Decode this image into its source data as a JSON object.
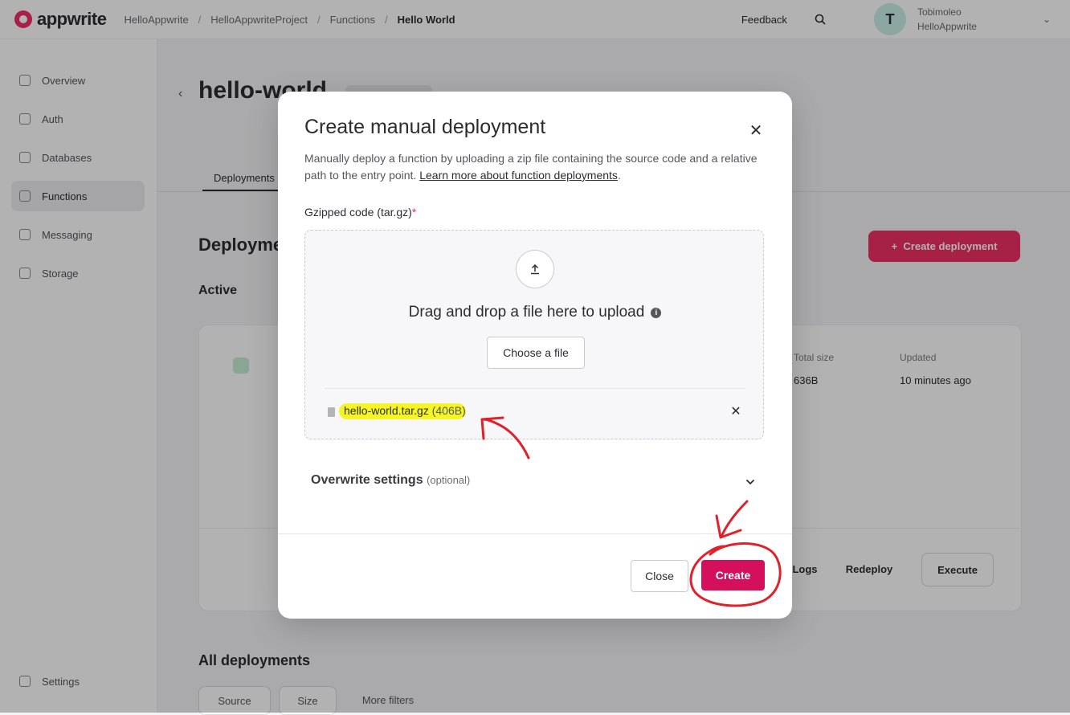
{
  "app": {
    "logo_text": "appwrite"
  },
  "breadcrumbs": [
    "HelloAppwrite",
    "HelloAppwriteProject",
    "Functions",
    "Hello World"
  ],
  "header": {
    "feedback": "Feedback",
    "user_initial": "T",
    "user_name": "Tobimoleo",
    "user_org": "HelloAppwrite"
  },
  "sidebar": {
    "items": [
      {
        "label": "Overview"
      },
      {
        "label": "Auth"
      },
      {
        "label": "Databases"
      },
      {
        "label": "Functions"
      },
      {
        "label": "Messaging"
      },
      {
        "label": "Storage"
      }
    ],
    "settings": "Settings"
  },
  "page": {
    "title": "hello-world",
    "tab": "Deployments",
    "section": "Deployments",
    "active": "Active",
    "create_deployment": "Create deployment",
    "all_deployments": "All deployments",
    "total_size_label": "Total size",
    "total_size_value": "636B",
    "updated_label": "Updated",
    "updated_value": "10 minutes ago",
    "btn_logs": "Logs",
    "btn_redeploy": "Redeploy",
    "btn_execute": "Execute",
    "filter_source": "Source",
    "filter_size": "Size",
    "more_filters": "More filters"
  },
  "modal": {
    "title": "Create manual deployment",
    "description": "Manually deploy a function by uploading a zip file containing the source code and a relative path to the entry point.",
    "learn_more": "Learn more about function deployments",
    "field_label": "Gzipped code (tar.gz)",
    "required_mark": "*",
    "dropzone_text": "Drag and drop a file here to upload",
    "choose_file": "Choose a file",
    "file_name": "hello-world.tar.gz",
    "file_size": "(406B)",
    "overwrite_label": "Overwrite settings",
    "overwrite_optional": "(optional)",
    "close": "Close",
    "create": "Create"
  },
  "colors": {
    "accent": "#f02e65",
    "create_button": "#d40f5c",
    "highlight": "#f4f400",
    "annotation": "#e0202a"
  }
}
